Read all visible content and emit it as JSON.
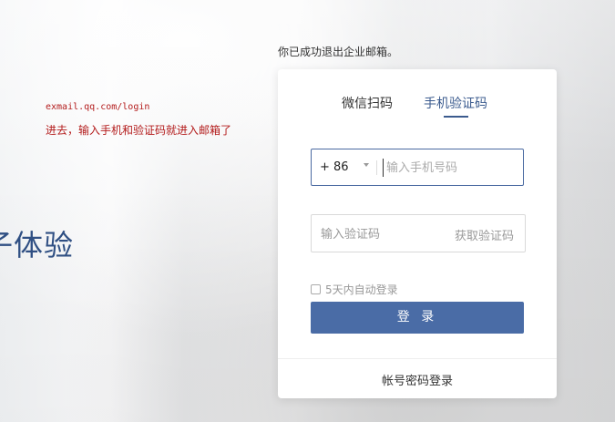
{
  "annotation": {
    "url": "exmail.qq.com/login",
    "note": "进去，输入手机和验证码就进入邮箱了"
  },
  "hero": {
    "text": "子体验"
  },
  "logout_message": "你已成功退出企业邮箱。",
  "login_panel": {
    "tabs": [
      {
        "label": "微信扫码",
        "active": false
      },
      {
        "label": "手机验证码",
        "active": true
      }
    ],
    "phone": {
      "country_code": "+ 86",
      "placeholder": "输入手机号码",
      "value": ""
    },
    "code": {
      "placeholder": "输入验证码",
      "value": "",
      "get_code_label": "获取验证码"
    },
    "remember_label": "5天内自动登录",
    "remember_checked": false,
    "login_label": "登 录",
    "password_login_label": "帐号密码登录"
  },
  "colors": {
    "accent": "#3b5b8e",
    "button": "#4a6ca6",
    "annotation": "#b31b1b"
  }
}
